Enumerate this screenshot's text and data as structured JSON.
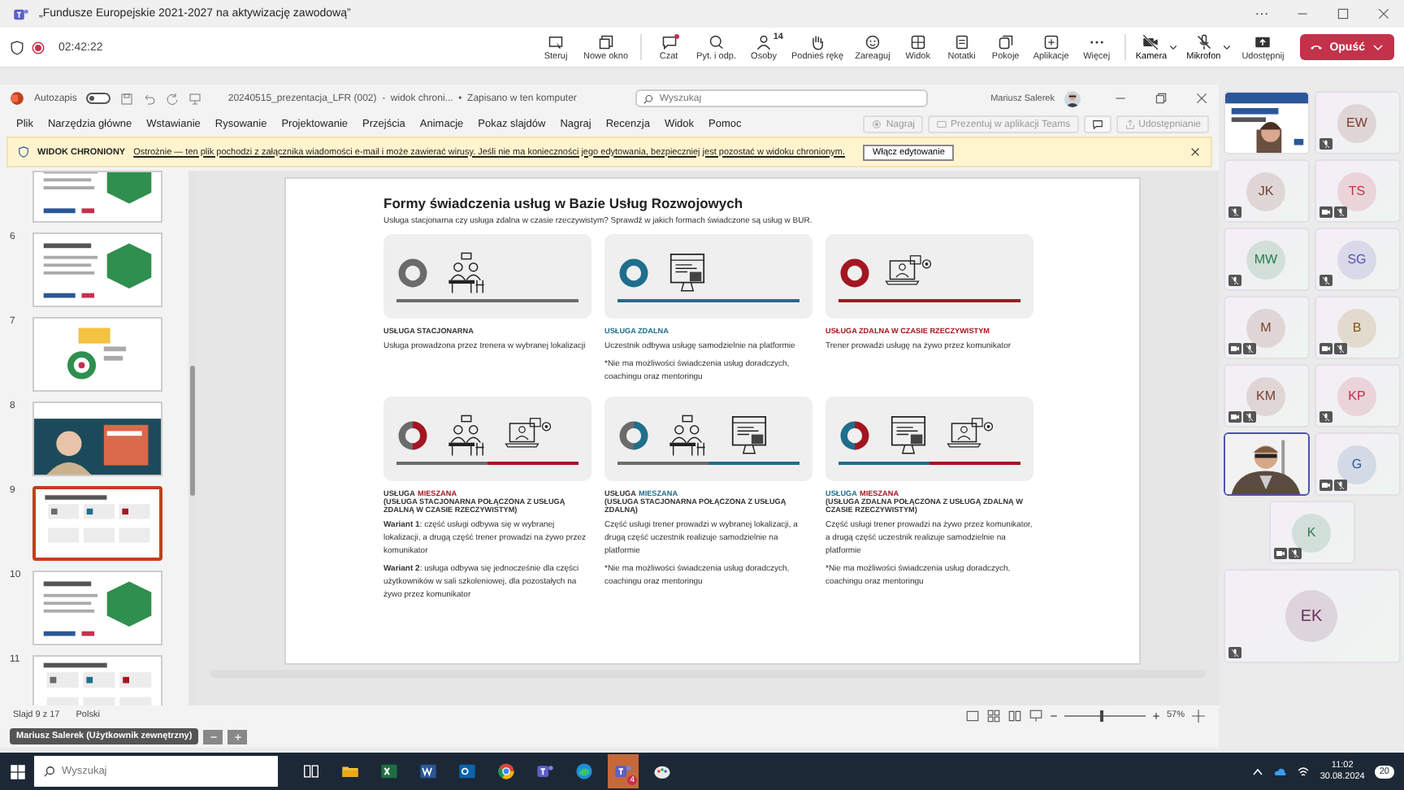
{
  "teams_window": {
    "title": "„Fundusze Europejskie 2021-2027 na aktywizację zawodową”",
    "timer": "02:42:22",
    "recording": true
  },
  "meeting_toolbar": [
    {
      "label": "Steruj"
    },
    {
      "label": "Nowe okno"
    },
    {
      "label": "Czat",
      "alert": true
    },
    {
      "label": "Pyt. i odp.",
      "alert": false
    },
    {
      "label": "Osoby",
      "count": "14"
    },
    {
      "label": "Podnieś rękę"
    },
    {
      "label": "Zareaguj"
    },
    {
      "label": "Widok"
    },
    {
      "label": "Notatki"
    },
    {
      "label": "Pokoje"
    },
    {
      "label": "Aplikacje"
    },
    {
      "label": "Więcej"
    }
  ],
  "device_controls": [
    {
      "label": "Kamera"
    },
    {
      "label": "Mikrofon"
    }
  ],
  "share_button": {
    "label": "Udostępnij"
  },
  "leave_button": {
    "label": "Opuść"
  },
  "powerpoint": {
    "autosave": {
      "label": "Autozapis",
      "on": false
    },
    "file_title": "20240515_prezentacja_LFR (002)  -  widok chroni...  •  Zapisano w ten komputer",
    "search": {
      "placeholder": "Wyszukaj"
    },
    "user": "Mariusz Salerek",
    "ribbon_tabs": [
      {
        "label": "Plik",
        "selected": false
      },
      {
        "label": "Narzędzia główne",
        "selected": false
      },
      {
        "label": "Wstawianie",
        "selected": false
      },
      {
        "label": "Rysowanie",
        "selected": false
      },
      {
        "label": "Projektowanie",
        "selected": false
      },
      {
        "label": "Przejścia",
        "selected": false
      },
      {
        "label": "Animacje",
        "selected": false
      },
      {
        "label": "Pokaz slajdów",
        "selected": false
      },
      {
        "label": "Nagraj",
        "selected": false
      },
      {
        "label": "Recenzja",
        "selected": false
      },
      {
        "label": "Widok",
        "selected": false
      },
      {
        "label": "Pomoc",
        "selected": false
      }
    ],
    "ribbon_actions": [
      {
        "label": "Nagraj",
        "disabled": true
      },
      {
        "label": "Prezentuj w aplikacji Teams",
        "disabled": true
      },
      {
        "disabled": false
      },
      {
        "label": "Udostępnianie",
        "disabled": true
      }
    ],
    "protected_view": {
      "title": "WIDOK CHRONIONY",
      "message": "Ostrożnie — ten plik pochodzi z załącznika wiadomości e-mail i może zawierać wirusy. Jeśli nie ma konieczności jego edytowania, bezpieczniej jest pozostać w widoku chronionym.",
      "button": "Włącz edytowanie"
    },
    "thumbnails": [
      {
        "selected": false
      },
      {
        "number": "6",
        "selected": false
      },
      {
        "number": "7",
        "selected": false
      },
      {
        "number": "8",
        "selected": false
      },
      {
        "number": "9",
        "selected": true
      },
      {
        "number": "10",
        "selected": false
      },
      {
        "number": "11",
        "selected": false
      }
    ],
    "slide": {
      "title": "Formy świadczenia usług w Bazie Usług Rozwojowych",
      "subtitle": "Usługa stacjonarna czy usługa zdalna w czasie rzeczywistym? Sprawdź w jakich formach świadczone są  usług w BUR.",
      "cards": [
        {
          "segments": [
            {
              "color": "#6b6b6b"
            }
          ],
          "illustrations": [
            {
              "kind": "classroom"
            }
          ],
          "label_parts": [
            {
              "text": "USŁUGA STACJONARNA",
              "color": "#333333"
            }
          ],
          "paragraphs": [
            "Usługa prowadzona przez trenera w wybranej lokalizacji"
          ]
        },
        {
          "segments": [
            {
              "color": "#1f6e8c"
            }
          ],
          "illustrations": [
            {
              "kind": "computer"
            }
          ],
          "label_parts": [
            {
              "text": "USŁUGA ZDALNA",
              "color": "#1f6e8c"
            }
          ],
          "paragraphs": [
            "Uczestnik odbywa usługę samodzielnie na platformie",
            "*Nie ma możliwości świadczenia usług doradczych, coachingu oraz mentoringu"
          ]
        },
        {
          "segments": [
            {
              "color": "#a31621"
            }
          ],
          "illustrations": [
            {
              "kind": "videocall"
            }
          ],
          "label_parts": [
            {
              "text": "USŁUGA ZDALNA W CZASIE RZECZYWISTYM",
              "color": "#a31621"
            }
          ],
          "paragraphs": [
            "Trener prowadzi usługę na żywo przez komunikator"
          ]
        },
        {
          "segments": [
            {
              "color": "#6b6b6b"
            },
            {
              "color": "#a31621"
            }
          ],
          "illustrations": [
            {
              "kind": "classroom"
            },
            {
              "kind": "videocall"
            }
          ],
          "label_parts": [
            {
              "text": "USŁUGA",
              "color": "#333333"
            },
            {
              "text": "MIESZANA",
              "color": "#a31621"
            }
          ],
          "sublabel": "(USŁUGA STACJONARNA POŁĄCZONA Z USŁUGĄ ZDALNĄ W CZASIE RZECZYWISTYM)",
          "paragraphs": [
            "**Wariant 1**: część usługi odbywa się w wybranej lokalizacji, a drugą część trener prowadzi na żywo przez komunikator",
            "**Wariant 2**: usługa odbywa się jednocześnie dla części użytkowników w sali szkoleniowej, dla pozostałych na żywo przez komunikator"
          ]
        },
        {
          "segments": [
            {
              "color": "#6b6b6b"
            },
            {
              "color": "#1f6e8c"
            }
          ],
          "illustrations": [
            {
              "kind": "classroom"
            },
            {
              "kind": "computer"
            }
          ],
          "label_parts": [
            {
              "text": "USŁUGA",
              "color": "#333333"
            },
            {
              "text": "MIESZANA",
              "color": "#1f6e8c"
            }
          ],
          "sublabel": "(USŁUGA STACJONARNA POŁĄCZONA Z USŁUGĄ ZDALNĄ)",
          "paragraphs": [
            "Część usługi trener prowadzi w wybranej lokalizacji, a drugą część uczestnik realizuje samodzielnie na platformie",
            "*Nie ma możliwości świadczenia usług doradczych, coachingu oraz mentoringu"
          ]
        },
        {
          "segments": [
            {
              "color": "#1f6e8c"
            },
            {
              "color": "#a31621"
            }
          ],
          "illustrations": [
            {
              "kind": "computer"
            },
            {
              "kind": "videocall"
            }
          ],
          "label_parts": [
            {
              "text": "USŁUGA",
              "color": "#1f6e8c"
            },
            {
              "text": "MIESZANA",
              "color": "#a31621"
            }
          ],
          "sublabel": "(USŁUGA ZDALNA POŁĄCZONA Z USŁUGĄ ZDALNĄ W CZASIE RZECZYWISTYM)",
          "paragraphs": [
            "Część usługi trener prowadzi na żywo przez komunikator, a drugą część uczestnik realizuje samodzielnie na platformie",
            "*Nie ma możliwości świadczenia usług doradczych, coachingu oraz mentoringu"
          ]
        }
      ]
    },
    "status_bar": {
      "slide_counter": "Slajd 9 z 17",
      "language": "Polski",
      "zoom": "57%",
      "level": 0.45
    }
  },
  "presenter_label": "Mariusz Salerek (Użytkownik zewnętrzny)",
  "participants": [
    {
      "kind": "video",
      "speaking": false
    },
    {
      "kind": "avatar",
      "initials": "EW",
      "color": "#7a3b2e",
      "muted": true,
      "camera_off": false
    },
    {
      "kind": "avatar",
      "initials": "JK",
      "color": "#7a3b2e",
      "muted": true,
      "camera_off": false
    },
    {
      "kind": "avatar",
      "initials": "TS",
      "color": "#c4314b",
      "muted": true,
      "camera_off": true
    },
    {
      "kind": "avatar",
      "initials": "MW",
      "color": "#237b4b",
      "muted": true,
      "camera_off": false
    },
    {
      "kind": "avatar",
      "initials": "SG",
      "color": "#4f52b2",
      "muted": true,
      "camera_off": false
    },
    {
      "kind": "avatar",
      "initials": "M",
      "color": "#7a3b2e",
      "muted": true,
      "camera_off": true
    },
    {
      "kind": "avatar",
      "initials": "B",
      "color": "#8a5500",
      "muted": true,
      "camera_off": true
    },
    {
      "kind": "avatar",
      "initials": "KM",
      "color": "#7a3b2e",
      "muted": true,
      "camera_off": true
    },
    {
      "kind": "avatar",
      "initials": "KP",
      "color": "#c4314b",
      "muted": true,
      "camera_off": false
    },
    {
      "kind": "video",
      "speaking": true
    },
    {
      "kind": "avatar",
      "initials": "G",
      "color": "#2b579a",
      "muted": true,
      "camera_off": true
    },
    {
      "kind": "avatar",
      "initials": "K",
      "color": "#237b4b",
      "muted": true,
      "camera_off": true
    },
    {
      "kind": "avatar",
      "initials": "EK",
      "color": "#6b2d5c",
      "muted": true,
      "camera_off": false
    }
  ],
  "taskbar": {
    "search": {
      "placeholder": "Wyszukaj"
    },
    "apps": [
      {
        "kind": "taskview",
        "active": false
      },
      {
        "kind": "folder",
        "active": false
      },
      {
        "kind": "excel",
        "active": false
      },
      {
        "kind": "word",
        "active": false
      },
      {
        "kind": "outlook",
        "active": false
      },
      {
        "kind": "chrome",
        "active": false
      },
      {
        "kind": "teams",
        "active": false
      },
      {
        "kind": "edge",
        "active": false
      },
      {
        "kind": "teams",
        "active": true,
        "badge": "4"
      },
      {
        "kind": "paint",
        "active": false
      }
    ],
    "time": "11:02",
    "date": "30.08.2024",
    "notifications": "20"
  }
}
